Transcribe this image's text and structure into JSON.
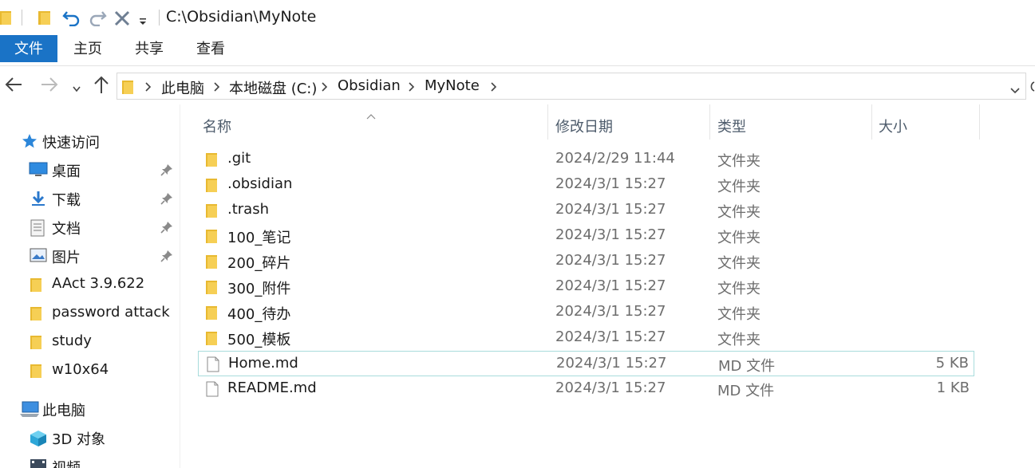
{
  "titlebar": {
    "path": "C:\\Obsidian\\MyNote",
    "icons": [
      "folder-icon",
      "folder-icon",
      "undo-icon",
      "redo-icon",
      "delete-icon",
      "customize-dropdown-icon"
    ]
  },
  "ribbon": {
    "tabs": [
      "文件",
      "主页",
      "共享",
      "查看"
    ]
  },
  "address": {
    "crumbs": [
      "此电脑",
      "本地磁盘 (C:)",
      "Obsidian",
      "MyNote"
    ]
  },
  "sidebar": {
    "quick_access": "快速访问",
    "items": [
      {
        "label": "桌面",
        "icon": "desktop-icon",
        "pinned": true
      },
      {
        "label": "下载",
        "icon": "download-icon",
        "pinned": true
      },
      {
        "label": "文档",
        "icon": "documents-icon",
        "pinned": true
      },
      {
        "label": "图片",
        "icon": "pictures-icon",
        "pinned": true
      },
      {
        "label": "AAct 3.9.622",
        "icon": "folder-icon",
        "pinned": false
      },
      {
        "label": "password attack",
        "icon": "folder-icon",
        "pinned": false
      },
      {
        "label": "study",
        "icon": "folder-icon",
        "pinned": false
      },
      {
        "label": "w10x64",
        "icon": "folder-icon",
        "pinned": false
      }
    ],
    "this_pc": "此电脑",
    "pc_items": [
      {
        "label": "3D 对象",
        "icon": "3d-objects-icon"
      },
      {
        "label": "视频",
        "icon": "videos-icon"
      }
    ]
  },
  "columns": {
    "name": "名称",
    "date": "修改日期",
    "type": "类型",
    "size": "大小"
  },
  "files": [
    {
      "name": ".git",
      "date": "2024/2/29 11:44",
      "type": "文件夹",
      "size": "",
      "kind": "folder"
    },
    {
      "name": ".obsidian",
      "date": "2024/3/1 15:27",
      "type": "文件夹",
      "size": "",
      "kind": "folder"
    },
    {
      "name": ".trash",
      "date": "2024/3/1 15:27",
      "type": "文件夹",
      "size": "",
      "kind": "folder"
    },
    {
      "name": "100_笔记",
      "date": "2024/3/1 15:27",
      "type": "文件夹",
      "size": "",
      "kind": "folder"
    },
    {
      "name": "200_碎片",
      "date": "2024/3/1 15:27",
      "type": "文件夹",
      "size": "",
      "kind": "folder"
    },
    {
      "name": "300_附件",
      "date": "2024/3/1 15:27",
      "type": "文件夹",
      "size": "",
      "kind": "folder"
    },
    {
      "name": "400_待办",
      "date": "2024/3/1 15:27",
      "type": "文件夹",
      "size": "",
      "kind": "folder"
    },
    {
      "name": "500_模板",
      "date": "2024/3/1 15:27",
      "type": "文件夹",
      "size": "",
      "kind": "folder"
    },
    {
      "name": "Home.md",
      "date": "2024/3/1 15:27",
      "type": "MD 文件",
      "size": "5 KB",
      "kind": "file"
    },
    {
      "name": "README.md",
      "date": "2024/3/1 15:27",
      "type": "MD 文件",
      "size": "1 KB",
      "kind": "file"
    }
  ],
  "colors": {
    "accent": "#1a73c6",
    "folder": "#f4c542",
    "selection_border": "#a8dcdc"
  }
}
